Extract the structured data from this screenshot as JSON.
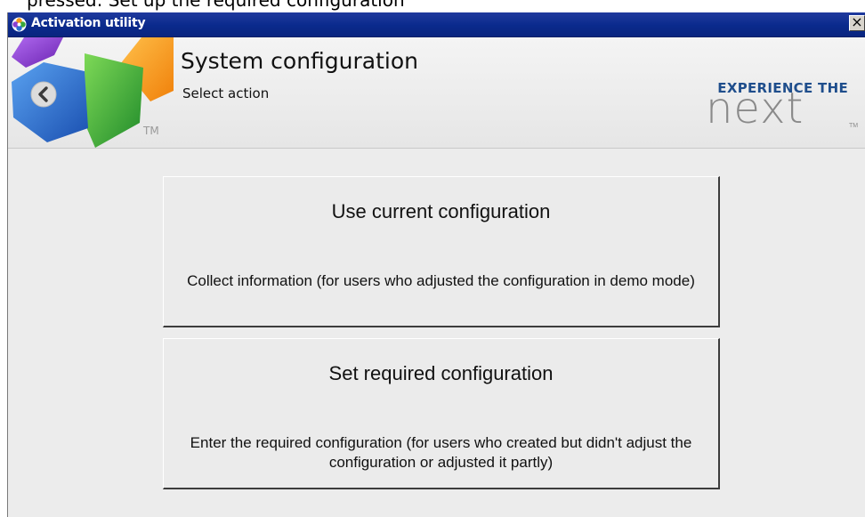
{
  "document_caption": "pressed: Set up the required configuration",
  "window": {
    "title": "Activation utility",
    "close_symbol": "×"
  },
  "header": {
    "title": "System configuration",
    "subtitle": "Select action",
    "logo_tm": "TM",
    "brand_tagline": "EXPERIENCE THE",
    "brand_name": "next",
    "brand_tm": "TM"
  },
  "actions": [
    {
      "title": "Use current configuration",
      "description": "Collect information (for users who adjusted the configuration in demo mode)"
    },
    {
      "title": "Set required configuration",
      "description": "Enter the required configuration (for users who created but didn't adjust the configuration or adjusted it partly)"
    }
  ],
  "icons": {
    "app": "colorful-flower-icon",
    "back": "back-arrow-icon",
    "close": "close-icon"
  },
  "colors": {
    "titlebar": "#0a2a8c",
    "brand_blue": "#1f4e8c",
    "logo_blue": "#2a6fd1",
    "logo_green": "#3aa83a",
    "logo_orange": "#f39a1b",
    "logo_purple": "#8a3fd1"
  }
}
